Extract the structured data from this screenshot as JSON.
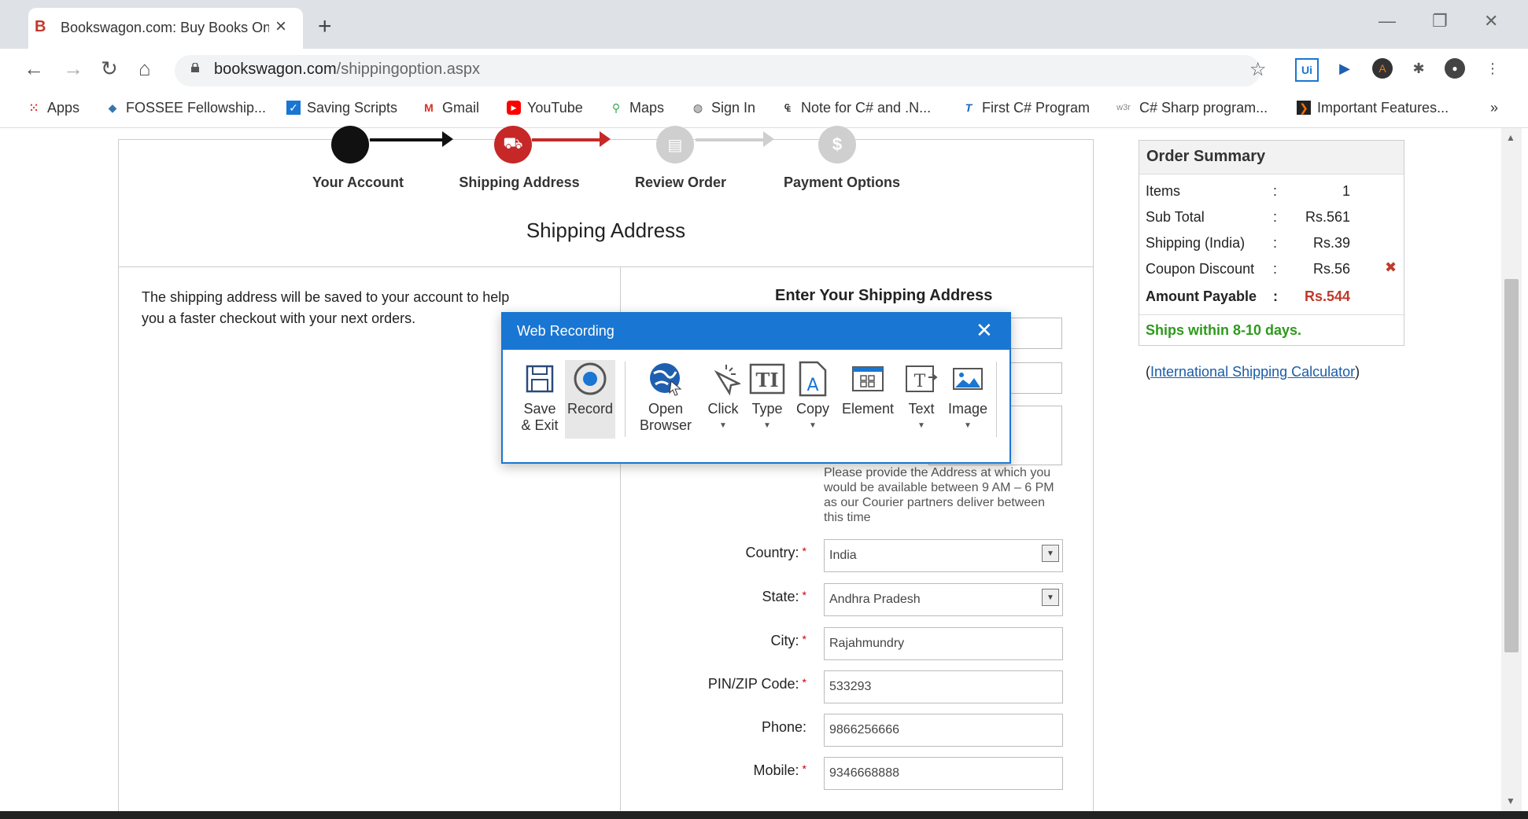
{
  "browser": {
    "tab_title": "Bookswagon.com: Buy Books Onl",
    "tab_favicon": "B",
    "url_host": "bookswagon.com",
    "url_path": "/shippingoption.aspx",
    "bookmarks": [
      {
        "label": "Apps",
        "icon": "apps-grid-icon"
      },
      {
        "label": "FOSSEE Fellowship...",
        "icon": "python-icon"
      },
      {
        "label": "Saving Scripts",
        "icon": "scripts-icon"
      },
      {
        "label": "Gmail",
        "icon": "gmail-icon"
      },
      {
        "label": "YouTube",
        "icon": "youtube-icon"
      },
      {
        "label": "Maps",
        "icon": "maps-icon"
      },
      {
        "label": "Sign In",
        "icon": "globe-icon"
      },
      {
        "label": "Note for C# and .N...",
        "icon": "note-icon"
      },
      {
        "label": "First C# Program",
        "icon": "t-icon"
      },
      {
        "label": "C# Sharp program...",
        "icon": "w3r-icon"
      },
      {
        "label": "Important Features...",
        "icon": "features-icon"
      }
    ],
    "more_bookmarks": "»"
  },
  "steps": [
    {
      "label": "Your Account",
      "state": "done"
    },
    {
      "label": "Shipping Address",
      "state": "active"
    },
    {
      "label": "Review Order",
      "state": "pending"
    },
    {
      "label": "Payment Options",
      "state": "pending"
    }
  ],
  "page": {
    "section_title": "Shipping Address",
    "help_text": "The shipping address will be saved to your account to help you a faster checkout with your next orders.",
    "form_title": "Enter Your Shipping Address",
    "address_note": "Please provide the Address at which you would be available between 9 AM – 6 PM as our Courier partners deliver between this time",
    "fields": {
      "country": {
        "label": "Country:",
        "value": "India"
      },
      "state": {
        "label": "State:",
        "value": "Andhra Pradesh"
      },
      "city": {
        "label": "City:",
        "value": "Rajahmundry"
      },
      "pin": {
        "label": "PIN/ZIP Code:",
        "value": "533293"
      },
      "phone": {
        "label": "Phone:",
        "value": "9866256666"
      },
      "mobile": {
        "label": "Mobile:",
        "value": "9346668888"
      }
    },
    "required_mark": "*"
  },
  "summary": {
    "title": "Order Summary",
    "rows": [
      {
        "k": "Items",
        "c": ":",
        "v": "1"
      },
      {
        "k": "Sub Total",
        "c": ":",
        "v": "Rs.561"
      },
      {
        "k": "Shipping (India)",
        "c": ":",
        "v": "Rs.39"
      },
      {
        "k": "Coupon Discount",
        "c": ":",
        "v": "Rs.56"
      },
      {
        "k": "Amount Payable",
        "c": ":",
        "v": "Rs.544"
      }
    ],
    "remove": "✖",
    "ships": "Ships within 8-10 days.",
    "calc_open": "(",
    "calc_link": "International Shipping Calculator",
    "calc_close": ")"
  },
  "dialog": {
    "title": "Web Recording",
    "tools": [
      {
        "label": "Save & Exit",
        "icon": "save-icon"
      },
      {
        "label": "Record",
        "icon": "record-icon"
      },
      {
        "label": "Open Browser",
        "icon": "globe-cursor-icon"
      },
      {
        "label": "Click",
        "icon": "click-icon"
      },
      {
        "label": "Type",
        "icon": "type-icon"
      },
      {
        "label": "Copy",
        "icon": "copy-icon"
      },
      {
        "label": "Element",
        "icon": "element-icon"
      },
      {
        "label": "Text",
        "icon": "text-icon"
      },
      {
        "label": "Image",
        "icon": "image-icon"
      }
    ]
  },
  "colors": {
    "accent_red": "#c0392b",
    "dialog_blue": "#1976d2",
    "ships_green": "#2e9a1c",
    "link_blue": "#1a5ca8"
  }
}
